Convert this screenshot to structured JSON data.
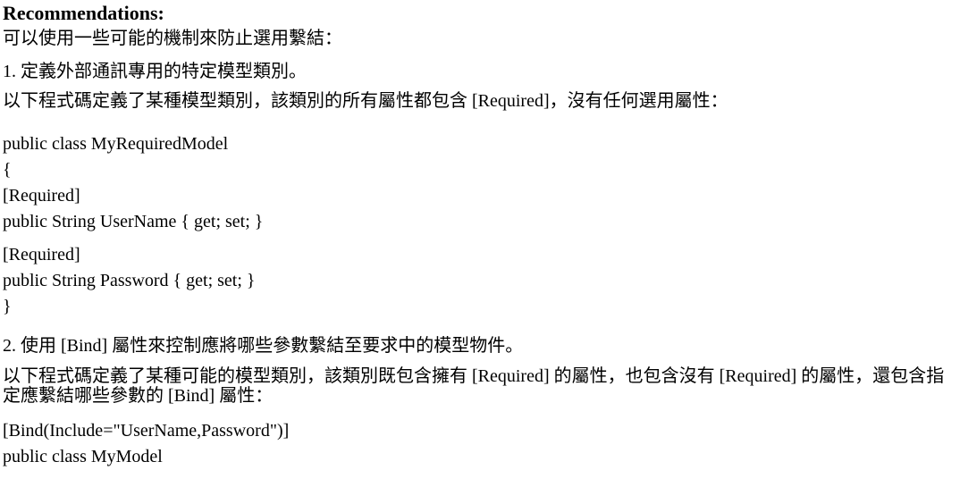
{
  "heading": "Recommendations:",
  "intro": "可以使用一些可能的機制來防止選用繫結：",
  "item1": "1. 定義外部通訊專用的特定模型類別。",
  "para1": "以下程式碼定義了某種模型類別，該類別的所有屬性都包含 [Required]，沒有任何選用屬性：",
  "code1": [
    "public class MyRequiredModel",
    "{",
    "[Required]",
    "public String UserName { get; set; }",
    "[Required]",
    "public String Password { get; set; }",
    "}"
  ],
  "item2": "2. 使用 [Bind] 屬性來控制應將哪些參數繫結至要求中的模型物件。",
  "para2": "以下程式碼定義了某種可能的模型類別，該類別既包含擁有 [Required] 的屬性，也包含沒有 [Required] 的屬性，還包含指定應繫結哪些參數的 [Bind] 屬性：",
  "code2": [
    "[Bind(Include=\"UserName,Password\")]",
    "public class MyModel"
  ]
}
